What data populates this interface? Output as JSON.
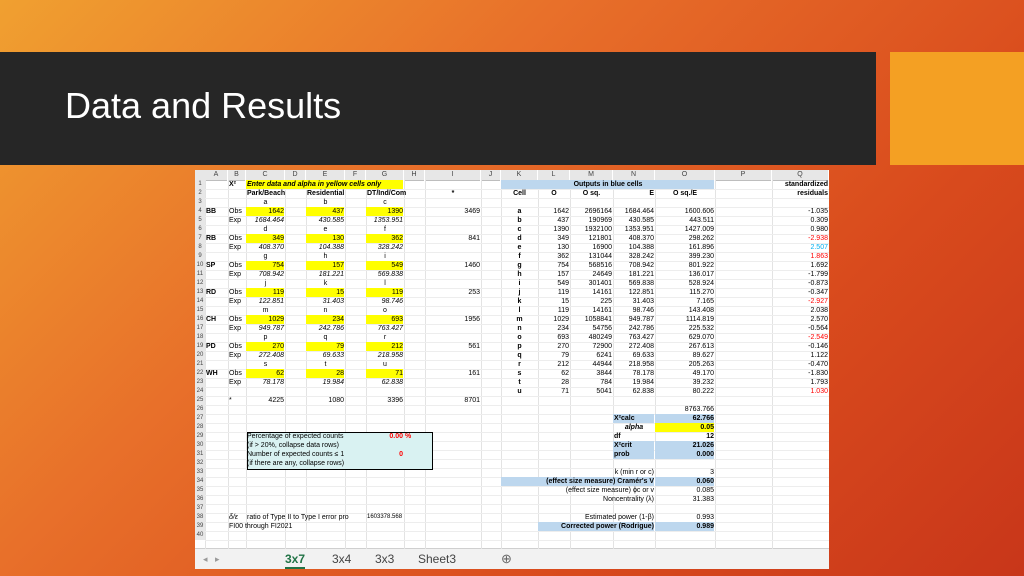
{
  "slide": {
    "title": "Data and Results"
  },
  "sheet": {
    "columns": [
      "A",
      "B",
      "C",
      "D",
      "E",
      "F",
      "G",
      "H",
      "I",
      "J",
      "K",
      "L",
      "M",
      "N",
      "O",
      "P",
      "Q"
    ],
    "rows": 40,
    "header_row1": {
      "b1": "X²",
      "instr": "Enter data and alpha in yellow cells only",
      "outputs": "Outputs in blue cells",
      "std1": "standardized",
      "std2": "residuals"
    },
    "header_row2": {
      "c": "Park/Beach",
      "e": "Residential",
      "g": "DT/Ind/Com",
      "i": "*",
      "k": "Cell",
      "l": "O",
      "m": "O sq.",
      "n": "E",
      "o": "O sq./E"
    },
    "groups": [
      {
        "name": "BB",
        "l1": "a",
        "l2": "b",
        "l3": "c",
        "obs": [
          "1642",
          "437",
          "1390"
        ],
        "exp": [
          "1684.464",
          "430.585",
          "1353.951"
        ],
        "total": "3469"
      },
      {
        "name": "RB",
        "l1": "d",
        "l2": "e",
        "l3": "f",
        "obs": [
          "349",
          "130",
          "362"
        ],
        "exp": [
          "408.370",
          "104.388",
          "328.242"
        ],
        "total": "841"
      },
      {
        "name": "SP",
        "l1": "g",
        "l2": "h",
        "l3": "i",
        "obs": [
          "754",
          "157",
          "549"
        ],
        "exp": [
          "708.942",
          "181.221",
          "569.838"
        ],
        "total": "1460"
      },
      {
        "name": "RD",
        "l1": "j",
        "l2": "k",
        "l3": "l",
        "obs": [
          "119",
          "15",
          "119"
        ],
        "exp": [
          "122.851",
          "31.403",
          "98.746"
        ],
        "total": "253"
      },
      {
        "name": "CH",
        "l1": "m",
        "l2": "n",
        "l3": "o",
        "obs": [
          "1029",
          "234",
          "693"
        ],
        "exp": [
          "949.787",
          "242.786",
          "763.427"
        ],
        "total": "1956"
      },
      {
        "name": "PD",
        "l1": "p",
        "l2": "q",
        "l3": "r",
        "obs": [
          "270",
          "79",
          "212"
        ],
        "exp": [
          "272.408",
          "69.633",
          "218.958"
        ],
        "total": "561"
      },
      {
        "name": "WH",
        "l1": "s",
        "l2": "t",
        "l3": "u",
        "obs": [
          "62",
          "28",
          "71"
        ],
        "exp": [
          "78.178",
          "19.984",
          "62.838"
        ],
        "total": "161"
      }
    ],
    "obs_label": "Obs",
    "exp_label": "Exp",
    "totals": {
      "star": "*",
      "c": "4225",
      "e": "1080",
      "g": "3396",
      "i": "8701"
    },
    "outputs": [
      {
        "cell": "a",
        "o": "1642",
        "osq": "2696164",
        "e": "1684.464",
        "ose": "1600.606",
        "res": "-1.035"
      },
      {
        "cell": "b",
        "o": "437",
        "osq": "190969",
        "e": "430.585",
        "ose": "443.511",
        "res": "0.309"
      },
      {
        "cell": "c",
        "o": "1390",
        "osq": "1932100",
        "e": "1353.951",
        "ose": "1427.009",
        "res": "0.980"
      },
      {
        "cell": "d",
        "o": "349",
        "osq": "121801",
        "e": "408.370",
        "ose": "298.262",
        "res": "-2.938"
      },
      {
        "cell": "e",
        "o": "130",
        "osq": "16900",
        "e": "104.388",
        "ose": "161.896",
        "res": "2.507"
      },
      {
        "cell": "f",
        "o": "362",
        "osq": "131044",
        "e": "328.242",
        "ose": "399.230",
        "res": "1.863"
      },
      {
        "cell": "g",
        "o": "754",
        "osq": "568516",
        "e": "708.942",
        "ose": "801.922",
        "res": "1.692"
      },
      {
        "cell": "h",
        "o": "157",
        "osq": "24649",
        "e": "181.221",
        "ose": "136.017",
        "res": "-1.799"
      },
      {
        "cell": "i",
        "o": "549",
        "osq": "301401",
        "e": "569.838",
        "ose": "528.924",
        "res": "-0.873"
      },
      {
        "cell": "j",
        "o": "119",
        "osq": "14161",
        "e": "122.851",
        "ose": "115.270",
        "res": "-0.347"
      },
      {
        "cell": "k",
        "o": "15",
        "osq": "225",
        "e": "31.403",
        "ose": "7.165",
        "res": "-2.927"
      },
      {
        "cell": "l",
        "o": "119",
        "osq": "14161",
        "e": "98.746",
        "ose": "143.408",
        "res": "2.038"
      },
      {
        "cell": "m",
        "o": "1029",
        "osq": "1058841",
        "e": "949.787",
        "ose": "1114.819",
        "res": "2.570"
      },
      {
        "cell": "n",
        "o": "234",
        "osq": "54756",
        "e": "242.786",
        "ose": "225.532",
        "res": "-0.564"
      },
      {
        "cell": "o",
        "o": "693",
        "osq": "480249",
        "e": "763.427",
        "ose": "629.070",
        "res": "-2.549"
      },
      {
        "cell": "p",
        "o": "270",
        "osq": "72900",
        "e": "272.408",
        "ose": "267.613",
        "res": "-0.146"
      },
      {
        "cell": "q",
        "o": "79",
        "osq": "6241",
        "e": "69.633",
        "ose": "89.627",
        "res": "1.122"
      },
      {
        "cell": "r",
        "o": "212",
        "osq": "44944",
        "e": "218.958",
        "ose": "205.263",
        "res": "-0.470"
      },
      {
        "cell": "s",
        "o": "62",
        "osq": "3844",
        "e": "78.178",
        "ose": "49.170",
        "res": "-1.830"
      },
      {
        "cell": "t",
        "o": "28",
        "osq": "784",
        "e": "19.984",
        "ose": "39.232",
        "res": "1.793"
      },
      {
        "cell": "u",
        "o": "71",
        "osq": "5041",
        "e": "62.838",
        "ose": "80.222",
        "res": "1.030"
      }
    ],
    "residual_colors": {
      "negative_strong": "#ff0000",
      "positive_strong": "#00b0f0",
      "normal": "#000000"
    },
    "sum_ose": "8763.766",
    "stats": {
      "x2calc_label": "X²calc",
      "x2calc": "62.766",
      "alpha_label": "alpha",
      "alpha": "0.05",
      "df_label": "df",
      "df": "12",
      "x2crit_label": "X²crit",
      "x2crit": "21.026",
      "prob_label": "prob",
      "prob": "0.000"
    },
    "pct_box": {
      "l1": "Percentage of expected counts",
      "v1": "0.00",
      "pct": "%",
      "l2": "(if > 20%, collapse data rows)",
      "l3": "Number of expected counts ≤ 1",
      "v3": "0",
      "l4": "(if there are any, collapse rows)"
    },
    "effect": {
      "k_label": "k (min r or c)",
      "k": "3",
      "cramer_label": "(effect size measure) Cramér's V",
      "cramer": "0.060",
      "phi_label": "(effect size measure) ϕc or v",
      "phi": "0.085",
      "nc_label": "Noncentrality (λ)",
      "nc": "31.383",
      "power_label": "Estimated power (1-β)",
      "power": "0.993",
      "cp_label": "Corrected power (Rodrigue)",
      "cp": "0.989"
    },
    "ratio": {
      "prefix": "δ/ε",
      "label": "ratio of Type II to Type I error pro",
      "value": "1603378.568"
    },
    "footer_note": "FI00 through FI2021",
    "tabs": [
      "3x7",
      "3x4",
      "3x3",
      "Sheet3"
    ],
    "active_tab": "3x7",
    "colors": {
      "yellow": "#ffff00",
      "blue": "#bdd7ee",
      "green": "#217346",
      "box": "#d9f2f2"
    }
  }
}
